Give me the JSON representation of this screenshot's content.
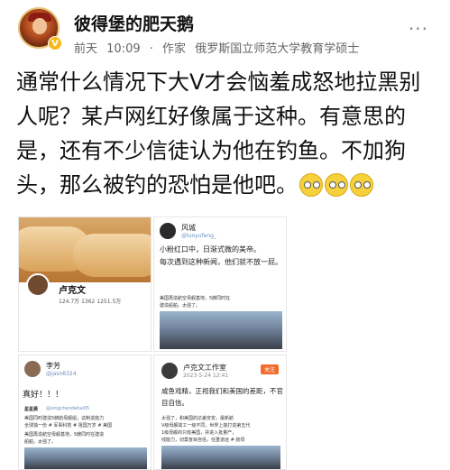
{
  "post": {
    "username": "彼得堡的肥天鹅",
    "time": "前天",
    "clock": "10:09",
    "author_label": "作家",
    "author_desc": "俄罗斯国立师范大学教育学硕士",
    "more": "···",
    "text_lines": [
      "通常什么情况下大V才会恼羞成怒地拉黑别",
      "人呢？某卢网红好像属于这种。有意思的",
      "是，还有不少信徒认为他在钓鱼。不加狗",
      "头，那么被钓的恐怕是他吧。"
    ],
    "emoji_count": 3
  },
  "images": {
    "img1": {
      "name": "卢克文",
      "stats": "124.7万   1362   1251.5万"
    },
    "img2": {
      "name": "风城",
      "handle": "@luoyufeng_",
      "line1": "小粉红口中，日渐式微的美帝。",
      "line2": "每次遇到这种新闻，他们就不放一屁。",
      "caption1": "美国再造航空母舰基地，5艘同时在",
      "caption2": "建造船舶。太强了。"
    },
    "img3": {
      "name": "李芳",
      "handle": "@jasn8324",
      "comment": "真好！！！",
      "repost_user": "星星晨",
      "repost_handle": "@xingchendahai05",
      "repost_line1": "美国同时建造5艘航母舰船，这制造能力",
      "repost_line2": "全球独一份 # 军事科技 # 祖国万岁 # 美国",
      "repost_line3": "美国再造航空母舰基地，5艘同时在建造",
      "repost_line4": "船舶。太强了。"
    },
    "img4": {
      "name": "卢克文工作室",
      "date": "2023-5-24 12:41",
      "follow": "关注",
      "line1": "咸鱼戏精，正视我们和美国的差距，不官",
      "line2": "目自信。",
      "detail1": "太强了，和美国的达差安安，最新航",
      "detail2": "V级母舰竣工一级不同，世界上能打造第五代",
      "detail3": "1级母舰的只有美国，并进入批量产，",
      "detail4": "线能力，切莫盲目自信，任重道远 # 航母"
    }
  },
  "colors": {
    "accent_orange": "#f26b2c",
    "vbadge": "#f5b91a",
    "link_blue": "#6a8ec0"
  },
  "icons": {
    "vbadge": "V"
  }
}
